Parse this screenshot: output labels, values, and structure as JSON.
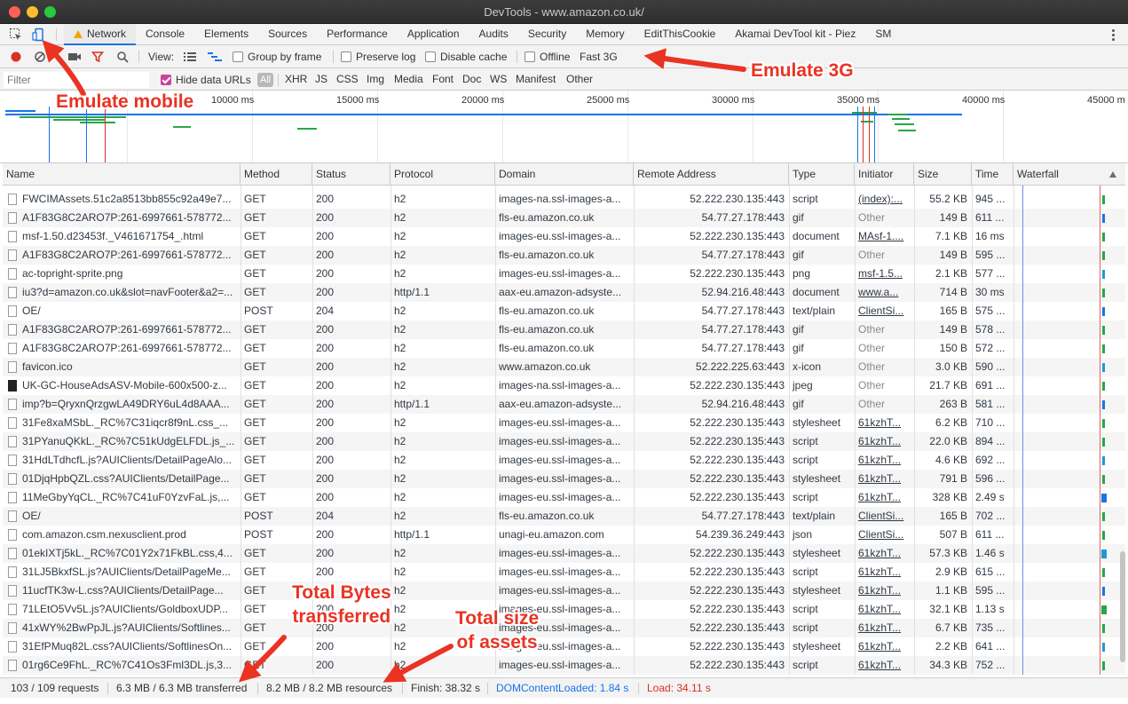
{
  "window": {
    "title": "DevTools - www.amazon.co.uk/"
  },
  "tabs": [
    "Network",
    "Console",
    "Elements",
    "Sources",
    "Performance",
    "Application",
    "Audits",
    "Security",
    "Memory",
    "EditThisCookie",
    "Akamai DevTool kit - Piez",
    "SM"
  ],
  "toolbar": {
    "view_label": "View:",
    "group_by_frame": "Group by frame",
    "preserve_log": "Preserve log",
    "disable_cache": "Disable cache",
    "offline": "Offline",
    "throttle": "Fast 3G"
  },
  "filterbar": {
    "placeholder": "Filter",
    "hide_data_urls": "Hide data URLs",
    "types": [
      "All",
      "XHR",
      "JS",
      "CSS",
      "Img",
      "Media",
      "Font",
      "Doc",
      "WS",
      "Manifest",
      "Other"
    ]
  },
  "overview": {
    "ticks": [
      "10000 ms",
      "15000 ms",
      "20000 ms",
      "25000 ms",
      "30000 ms",
      "35000 ms",
      "40000 ms",
      "45000 m"
    ]
  },
  "columns": [
    "Name",
    "Method",
    "Status",
    "Protocol",
    "Domain",
    "Remote Address",
    "Type",
    "Initiator",
    "Size",
    "Time",
    "Waterfall"
  ],
  "rows": [
    {
      "name": "FWCIMAssets.51c2a8513bb855c92a49e7...",
      "method": "GET",
      "status": "200",
      "protocol": "h2",
      "domain": "images-na.ssl-images-a...",
      "remote": "52.222.230.135:443",
      "type": "script",
      "initiator": "(index):...",
      "size": "55.2 KB",
      "time": "945 ..."
    },
    {
      "name": "A1F83G8C2ARO7P:261-6997661-578772...",
      "method": "GET",
      "status": "200",
      "protocol": "h2",
      "domain": "fls-eu.amazon.co.uk",
      "remote": "54.77.27.178:443",
      "type": "gif",
      "initiator": "Other",
      "size": "149 B",
      "time": "611 ..."
    },
    {
      "name": "msf-1.50.d23453f._V461671754_.html",
      "method": "GET",
      "status": "200",
      "protocol": "h2",
      "domain": "images-eu.ssl-images-a...",
      "remote": "52.222.230.135:443",
      "type": "document",
      "initiator": "MAsf-1....",
      "size": "7.1 KB",
      "time": "16 ms"
    },
    {
      "name": "A1F83G8C2ARO7P:261-6997661-578772...",
      "method": "GET",
      "status": "200",
      "protocol": "h2",
      "domain": "fls-eu.amazon.co.uk",
      "remote": "54.77.27.178:443",
      "type": "gif",
      "initiator": "Other",
      "size": "149 B",
      "time": "595 ..."
    },
    {
      "name": "ac-topright-sprite.png",
      "method": "GET",
      "status": "200",
      "protocol": "h2",
      "domain": "images-eu.ssl-images-a...",
      "remote": "52.222.230.135:443",
      "type": "png",
      "initiator": "msf-1.5...",
      "size": "2.1 KB",
      "time": "577 ..."
    },
    {
      "name": "iu3?d=amazon.co.uk&slot=navFooter&a2=...",
      "method": "GET",
      "status": "200",
      "protocol": "http/1.1",
      "domain": "aax-eu.amazon-adsyste...",
      "remote": "52.94.216.48:443",
      "type": "document",
      "initiator": "www.a...",
      "size": "714 B",
      "time": "30 ms"
    },
    {
      "name": "OE/",
      "method": "POST",
      "status": "204",
      "protocol": "h2",
      "domain": "fls-eu.amazon.co.uk",
      "remote": "54.77.27.178:443",
      "type": "text/plain",
      "initiator": "ClientSi...",
      "size": "165 B",
      "time": "575 ..."
    },
    {
      "name": "A1F83G8C2ARO7P:261-6997661-578772...",
      "method": "GET",
      "status": "200",
      "protocol": "h2",
      "domain": "fls-eu.amazon.co.uk",
      "remote": "54.77.27.178:443",
      "type": "gif",
      "initiator": "Other",
      "size": "149 B",
      "time": "578 ..."
    },
    {
      "name": "A1F83G8C2ARO7P:261-6997661-578772...",
      "method": "GET",
      "status": "200",
      "protocol": "h2",
      "domain": "fls-eu.amazon.co.uk",
      "remote": "54.77.27.178:443",
      "type": "gif",
      "initiator": "Other",
      "size": "150 B",
      "time": "572 ..."
    },
    {
      "name": "favicon.ico",
      "method": "GET",
      "status": "200",
      "protocol": "h2",
      "domain": "www.amazon.co.uk",
      "remote": "52.222.225.63:443",
      "type": "x-icon",
      "initiator": "Other",
      "size": "3.0 KB",
      "time": "590 ..."
    },
    {
      "name": "UK-GC-HouseAdsASV-Mobile-600x500-z...",
      "method": "GET",
      "status": "200",
      "protocol": "h2",
      "domain": "images-na.ssl-images-a...",
      "remote": "52.222.230.135:443",
      "type": "jpeg",
      "initiator": "Other",
      "size": "21.7 KB",
      "time": "691 ..."
    },
    {
      "name": "imp?b=QryxnQrzgwLA49DRY6uL4d8AAA...",
      "method": "GET",
      "status": "200",
      "protocol": "http/1.1",
      "domain": "aax-eu.amazon-adsyste...",
      "remote": "52.94.216.48:443",
      "type": "gif",
      "initiator": "Other",
      "size": "263 B",
      "time": "581 ..."
    },
    {
      "name": "31Fe8xaMSbL._RC%7C31iqcr8f9nL.css_...",
      "method": "GET",
      "status": "200",
      "protocol": "h2",
      "domain": "images-eu.ssl-images-a...",
      "remote": "52.222.230.135:443",
      "type": "stylesheet",
      "initiator": "61kzhT...",
      "size": "6.2 KB",
      "time": "710 ..."
    },
    {
      "name": "31PYanuQKkL._RC%7C51kUdgELFDL.js_...",
      "method": "GET",
      "status": "200",
      "protocol": "h2",
      "domain": "images-eu.ssl-images-a...",
      "remote": "52.222.230.135:443",
      "type": "script",
      "initiator": "61kzhT...",
      "size": "22.0 KB",
      "time": "894 ..."
    },
    {
      "name": "31HdLTdhcfL.js?AUIClients/DetailPageAlo...",
      "method": "GET",
      "status": "200",
      "protocol": "h2",
      "domain": "images-eu.ssl-images-a...",
      "remote": "52.222.230.135:443",
      "type": "script",
      "initiator": "61kzhT...",
      "size": "4.6 KB",
      "time": "692 ..."
    },
    {
      "name": "01DjqHpbQZL.css?AUIClients/DetailPage...",
      "method": "GET",
      "status": "200",
      "protocol": "h2",
      "domain": "images-eu.ssl-images-a...",
      "remote": "52.222.230.135:443",
      "type": "stylesheet",
      "initiator": "61kzhT...",
      "size": "791 B",
      "time": "596 ..."
    },
    {
      "name": "11MeGbyYqCL._RC%7C41uF0YzvFaL.js,...",
      "method": "GET",
      "status": "200",
      "protocol": "h2",
      "domain": "images-eu.ssl-images-a...",
      "remote": "52.222.230.135:443",
      "type": "script",
      "initiator": "61kzhT...",
      "size": "328 KB",
      "time": "2.49 s"
    },
    {
      "name": "OE/",
      "method": "POST",
      "status": "204",
      "protocol": "h2",
      "domain": "fls-eu.amazon.co.uk",
      "remote": "54.77.27.178:443",
      "type": "text/plain",
      "initiator": "ClientSi...",
      "size": "165 B",
      "time": "702 ..."
    },
    {
      "name": "com.amazon.csm.nexusclient.prod",
      "method": "POST",
      "status": "200",
      "protocol": "http/1.1",
      "domain": "unagi-eu.amazon.com",
      "remote": "54.239.36.249:443",
      "type": "json",
      "initiator": "ClientSi...",
      "size": "507 B",
      "time": "611 ..."
    },
    {
      "name": "01ekIXTj5kL._RC%7C01Y2x71FkBL.css,4...",
      "method": "GET",
      "status": "200",
      "protocol": "h2",
      "domain": "images-eu.ssl-images-a...",
      "remote": "52.222.230.135:443",
      "type": "stylesheet",
      "initiator": "61kzhT...",
      "size": "57.3 KB",
      "time": "1.46 s"
    },
    {
      "name": "31LJ5BkxfSL.js?AUIClients/DetailPageMe...",
      "method": "GET",
      "status": "200",
      "protocol": "h2",
      "domain": "images-eu.ssl-images-a...",
      "remote": "52.222.230.135:443",
      "type": "script",
      "initiator": "61kzhT...",
      "size": "2.9 KB",
      "time": "615 ..."
    },
    {
      "name": "11ucfTK3w-L.css?AUIClients/DetailPage...",
      "method": "GET",
      "status": "200",
      "protocol": "h2",
      "domain": "images-eu.ssl-images-a...",
      "remote": "52.222.230.135:443",
      "type": "stylesheet",
      "initiator": "61kzhT...",
      "size": "1.1 KB",
      "time": "595 ..."
    },
    {
      "name": "71LEtO5Vv5L.js?AUIClients/GoldboxUDP...",
      "method": "GET",
      "status": "200",
      "protocol": "h2",
      "domain": "images-eu.ssl-images-a...",
      "remote": "52.222.230.135:443",
      "type": "script",
      "initiator": "61kzhT...",
      "size": "32.1 KB",
      "time": "1.13 s"
    },
    {
      "name": "41xWY%2BwPpJL.js?AUIClients/Softlines...",
      "method": "GET",
      "status": "200",
      "protocol": "h2",
      "domain": "images-eu.ssl-images-a...",
      "remote": "52.222.230.135:443",
      "type": "script",
      "initiator": "61kzhT...",
      "size": "6.7 KB",
      "time": "735 ..."
    },
    {
      "name": "31EfPMuq82L.css?AUIClients/SoftlinesOn...",
      "method": "GET",
      "status": "200",
      "protocol": "h2",
      "domain": "images-eu.ssl-images-a...",
      "remote": "52.222.230.135:443",
      "type": "stylesheet",
      "initiator": "61kzhT...",
      "size": "2.2 KB",
      "time": "641 ..."
    },
    {
      "name": "01rg6Ce9FhL._RC%7C41Os3Fml3DL.js,3...",
      "method": "GET",
      "status": "200",
      "protocol": "h2",
      "domain": "images-eu.ssl-images-a...",
      "remote": "52.222.230.135:443",
      "type": "script",
      "initiator": "61kzhT...",
      "size": "34.3 KB",
      "time": "752 ..."
    }
  ],
  "statusbar": {
    "requests": "103 / 109 requests",
    "transferred": "6.3 MB / 6.3 MB transferred",
    "resources": "8.2 MB / 8.2 MB resources",
    "finish": "Finish: 38.32 s",
    "domcontentloaded": "DOMContentLoaded: 1.84 s",
    "load": "Load: 34.11 s"
  },
  "annotations": {
    "emulate_mobile": "Emulate mobile",
    "emulate_3g": "Emulate 3G",
    "total_bytes_line1": "Total Bytes",
    "total_bytes_line2": "transferred",
    "total_size_line1": "Total size",
    "total_size_line2": "of assets"
  },
  "colors": {
    "record": "#d93025",
    "accent": "#1a73e8",
    "annotation": "#ea3323",
    "dcl": "#1a73e8",
    "load": "#d93025",
    "checkbox": "#c6469a"
  },
  "icons": [
    "inspect-element-icon",
    "device-toggle-icon",
    "record-icon",
    "clear-icon",
    "camera-icon",
    "filter-icon",
    "search-icon",
    "list-view-icon",
    "waterfall-view-icon",
    "warning-icon",
    "more-options-icon",
    "file-icon",
    "sort-ascending-icon"
  ]
}
